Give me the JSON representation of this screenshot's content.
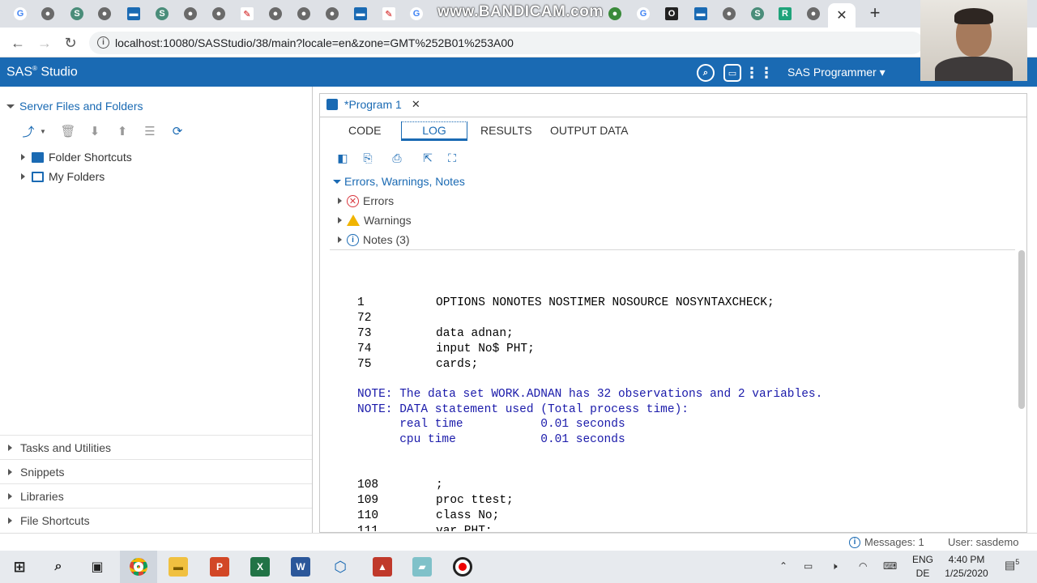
{
  "browser": {
    "watermark": "www.BANDICAM.com",
    "url": "localhost:10080/SASStudio/38/main?locale=en&zone=GMT%252B01%253A00",
    "active_tab_close": "✕",
    "new_tab": "+"
  },
  "header": {
    "brand": "SAS",
    "brand_mark": "®",
    "brand_suffix": " Studio",
    "user_menu": "SAS Programmer ▾"
  },
  "left_pane": {
    "title": "Server Files and Folders",
    "tree": [
      {
        "label": "Folder Shortcuts"
      },
      {
        "label": "My Folders"
      }
    ],
    "sections": [
      {
        "label": "Tasks and Utilities"
      },
      {
        "label": "Snippets"
      },
      {
        "label": "Libraries"
      },
      {
        "label": "File Shortcuts"
      }
    ]
  },
  "main": {
    "program_tab": "*Program 1",
    "program_tab_close": "✕",
    "view_tabs": [
      "CODE",
      "LOG",
      "RESULTS",
      "OUTPUT DATA"
    ],
    "active_view_tab": "LOG",
    "ewn": {
      "title": "Errors, Warnings, Notes",
      "items": [
        {
          "label": "Errors"
        },
        {
          "label": "Warnings"
        },
        {
          "label": "Notes (3)"
        }
      ]
    },
    "log": {
      "lines": [
        {
          "ln": "1",
          "code": "OPTIONS NONOTES NOSTIMER NOSOURCE NOSYNTAXCHECK;"
        },
        {
          "ln": "72",
          "code": ""
        },
        {
          "ln": "73",
          "code": "data adnan;"
        },
        {
          "ln": "74",
          "code": "input No$ PHT;"
        },
        {
          "ln": "75",
          "code": "cards;"
        }
      ],
      "notes": [
        "NOTE: The data set WORK.ADNAN has 32 observations and 2 variables.",
        "NOTE: DATA statement used (Total process time):",
        "      real time           0.01 seconds",
        "      cpu time            0.01 seconds"
      ],
      "lines2": [
        {
          "ln": "108",
          "code": ";"
        },
        {
          "ln": "109",
          "code": "proc ttest;"
        },
        {
          "ln": "110",
          "code": "class No;"
        },
        {
          "ln": "111",
          "code": "var PHT;"
        }
      ]
    }
  },
  "status": {
    "messages": "Messages: 1",
    "user": "User: sasdemo"
  },
  "taskbar": {
    "lang_top": "ENG",
    "lang_bottom": "DE",
    "time": "4:40 PM",
    "date": "1/25/2020",
    "notif_count": "5"
  }
}
